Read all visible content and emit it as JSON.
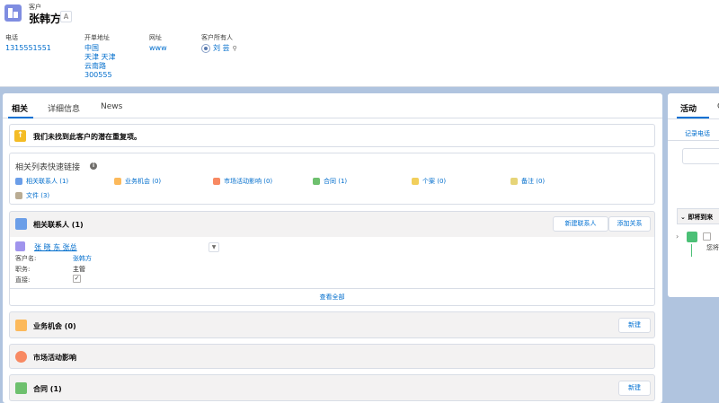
{
  "header": {
    "object_label": "客户",
    "record_name": "张韩方",
    "follow_glyph": "A",
    "fields": [
      {
        "label": "电话",
        "lines": [
          "1315551551"
        ]
      },
      {
        "label": "开单地址",
        "lines": [
          "中国",
          "天津 天津",
          "云南路",
          "300555"
        ]
      },
      {
        "label": "网址",
        "lines": [
          "www"
        ]
      },
      {
        "label": "客户所有人",
        "lines": [
          "刘 芸"
        ]
      }
    ]
  },
  "tabs": [
    "相关",
    "详细信息",
    "News"
  ],
  "duplicate_notice": "我们未找到此客户的潜在重复项。",
  "quick_links": {
    "title": "相关列表快速链接",
    "items": [
      {
        "label": "相关联系人 (1)",
        "color": "#6b9ee8"
      },
      {
        "label": "业务机会 (0)",
        "color": "#fcb95b"
      },
      {
        "label": "市场活动影响 (0)",
        "color": "#f88962"
      },
      {
        "label": "合同 (1)",
        "color": "#6ec06e"
      },
      {
        "label": "个案 (0)",
        "color": "#f2cf5b"
      },
      {
        "label": "备注 (0)",
        "color": "#e6d478"
      },
      {
        "label": "文件 (3)",
        "color": "#baac93"
      }
    ]
  },
  "cards": {
    "contacts": {
      "title": "相关联系人 (1)",
      "buttons": [
        "新建联系人",
        "添加关系"
      ],
      "record": {
        "name": "张 晓 东 张总",
        "rows": [
          {
            "label": "客户名:",
            "value": "张韩方"
          },
          {
            "label": "职务:",
            "value": "主管"
          },
          {
            "label": "直接:",
            "value": "✓"
          }
        ]
      },
      "view_all": "查看全部"
    },
    "opportunities": {
      "title": "业务机会 (0)",
      "button": "新建"
    },
    "campaign": {
      "title": "市场活动影响"
    },
    "contract": {
      "title": "合同 (1)",
      "button": "新建"
    }
  },
  "side": {
    "tab": "活动",
    "more_tab": "C",
    "log_call": "记录电话",
    "upcoming": "即将到来",
    "task_text": "您将"
  },
  "colors": {
    "accent": "#0070d2",
    "account_icon": "#7f8de1",
    "contact_icon": "#6b9ee8",
    "opportunity_icon": "#fcb95b",
    "campaign_icon": "#f88962",
    "contract_icon": "#6ec06e"
  }
}
